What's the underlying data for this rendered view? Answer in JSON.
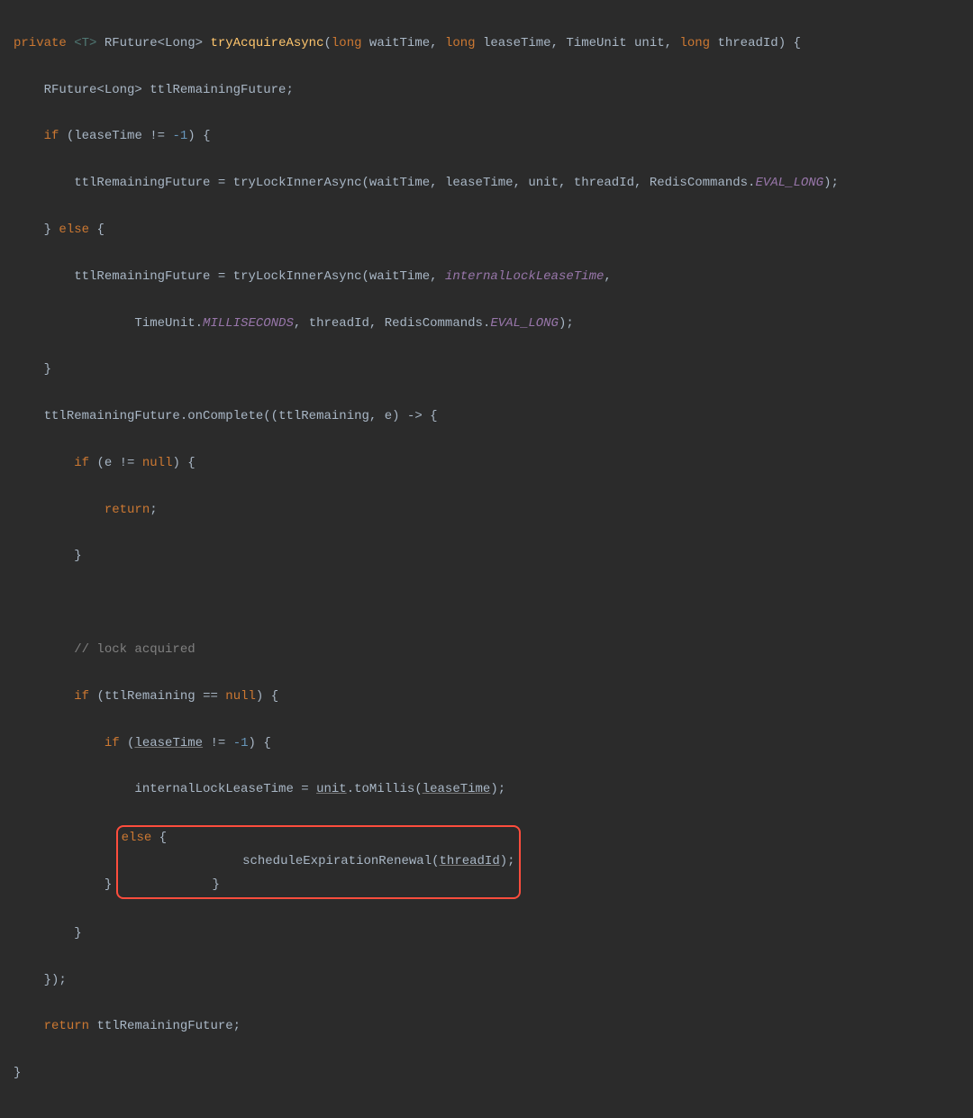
{
  "tokens": {
    "private": "private",
    "generic": "<T>",
    "rfuture_long": "RFuture<Long>",
    "method": "tryAcquireAsync",
    "long_t": "long",
    "p_waitTime": "waitTime",
    "p_leaseTime": "leaseTime",
    "TimeUnit": "TimeUnit",
    "p_unit": "unit",
    "p_threadId": "threadId",
    "decl_ttlRemainingFuture": "ttlRemainingFuture",
    "if": "if",
    "else": "else",
    "neg1": "-1",
    "ttlrf": "ttlRemainingFuture",
    "tryLockInnerAsync": "tryLockInnerAsync",
    "RedisCommands": "RedisCommands",
    "EVAL_LONG": "EVAL_LONG",
    "internalLockLeaseTime": "internalLockLeaseTime",
    "MILLISECONDS": "MILLISECONDS",
    "onComplete": "onComplete",
    "ttlRemaining": "ttlRemaining",
    "e": "e",
    "null": "null",
    "return": "return",
    "comment_lock": "// lock acquired",
    "toMillis": "toMillis",
    "scheduleExpirationRenewal": "scheduleExpirationRenewal",
    "ne": "!=",
    "eq": "==",
    "assign": "=",
    "arrow": "->",
    "dot": ".",
    "comma": ",",
    "semi": ";",
    "lparen": "(",
    "rparen": ")",
    "lbrace": "{",
    "rbrace": "}"
  }
}
